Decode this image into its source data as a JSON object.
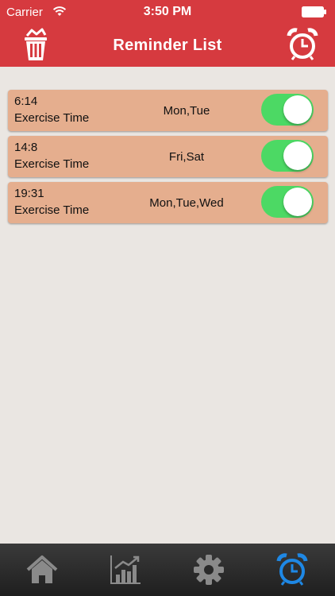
{
  "status_bar": {
    "carrier": "Carrier",
    "time": "3:50 PM"
  },
  "header": {
    "title": "Reminder List",
    "left_icon": "trash-icon",
    "right_icon": "alarm-clock-icon"
  },
  "reminders": [
    {
      "time": "6:14",
      "label": "Exercise Time",
      "days": "Mon,Tue",
      "enabled": true
    },
    {
      "time": "14:8",
      "label": "Exercise Time",
      "days": "Fri,Sat",
      "enabled": true
    },
    {
      "time": "19:31",
      "label": "Exercise Time",
      "days": "Mon,Tue,Wed",
      "enabled": true
    }
  ],
  "tabbar": {
    "tabs": [
      {
        "icon": "home-icon",
        "active": false
      },
      {
        "icon": "chart-icon",
        "active": false
      },
      {
        "icon": "gear-icon",
        "active": false
      },
      {
        "icon": "alarm-clock-icon",
        "active": true
      }
    ]
  },
  "colors": {
    "header": "#d63a3f",
    "row": "#e5ae8e",
    "toggle_on": "#4cd964",
    "tab_active": "#1e88e5",
    "tab_inactive": "#8a8a8a",
    "background": "#eae6e2"
  }
}
